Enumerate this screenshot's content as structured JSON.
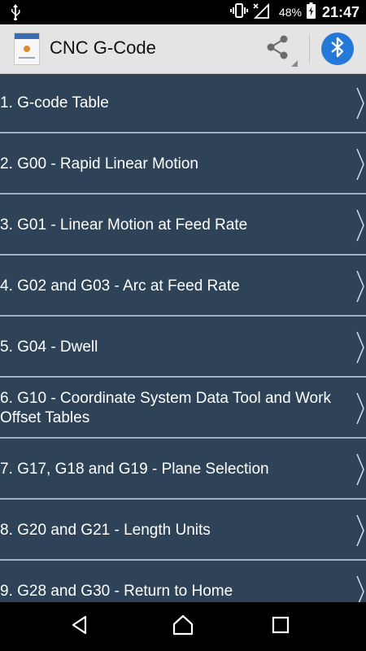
{
  "status_bar": {
    "battery_percent": "48%",
    "time": "21:47",
    "icons": [
      "usb-icon",
      "vibrate-icon",
      "no-signal-icon",
      "cell-signal-icon",
      "battery-charging-icon"
    ]
  },
  "action_bar": {
    "title": "CNC G-Code",
    "logo_icon": "app-logo-icon",
    "share_icon": "share-icon",
    "bluetooth_icon": "bluetooth-icon",
    "accent_color": "#2378d8"
  },
  "list": {
    "items": [
      {
        "label": "1. G-code Table"
      },
      {
        "label": "2. G00 - Rapid Linear Motion"
      },
      {
        "label": "3. G01 - Linear Motion at Feed Rate"
      },
      {
        "label": "4. G02 and G03 - Arc at Feed Rate"
      },
      {
        "label": "5. G04 - Dwell"
      },
      {
        "label": "6. G10 - Coordinate System Data Tool and Work Offset Tables"
      },
      {
        "label": "7. G17, G18 and G19 - Plane Selection"
      },
      {
        "label": "8. G20 and G21 - Length Units"
      },
      {
        "label": "9. G28 and G30 - Return to Home"
      }
    ],
    "background_color": "#2f4358",
    "separator_color": "#9fb0c3"
  },
  "nav_bar": {
    "icons": [
      "back-icon",
      "home-icon",
      "recents-icon"
    ]
  }
}
